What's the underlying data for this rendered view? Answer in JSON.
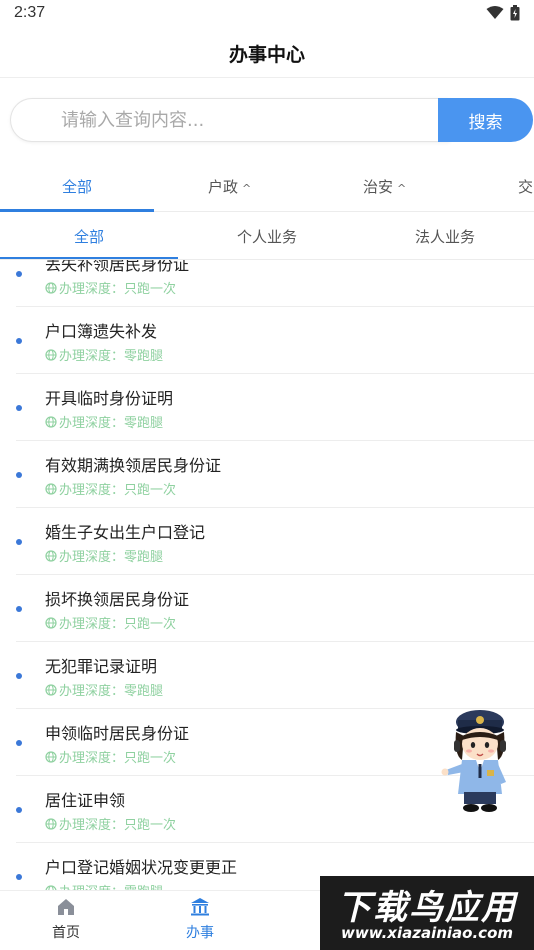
{
  "status_bar": {
    "time": "2:37"
  },
  "header": {
    "title": "办事中心"
  },
  "search": {
    "placeholder": "请输入查询内容...",
    "button_label": "搜索"
  },
  "category_tabs": [
    {
      "label": "全部",
      "active": true,
      "has_caret": false
    },
    {
      "label": "户政",
      "active": false,
      "has_caret": true
    },
    {
      "label": "治安",
      "active": false,
      "has_caret": true
    },
    {
      "label": "交",
      "active": false,
      "has_caret": false
    }
  ],
  "sub_tabs": [
    {
      "label": "全部",
      "active": true
    },
    {
      "label": "个人业务",
      "active": false
    },
    {
      "label": "法人业务",
      "active": false
    }
  ],
  "list": {
    "depth_prefix": "办理深度：",
    "items": [
      {
        "title": "丢失补领居民身份证",
        "depth": "只跑一次"
      },
      {
        "title": "户口簿遗失补发",
        "depth": "零跑腿"
      },
      {
        "title": "开具临时身份证明",
        "depth": "零跑腿"
      },
      {
        "title": "有效期满换领居民身份证",
        "depth": "只跑一次"
      },
      {
        "title": "婚生子女出生户口登记",
        "depth": "零跑腿"
      },
      {
        "title": "损坏换领居民身份证",
        "depth": "只跑一次"
      },
      {
        "title": "无犯罪记录证明",
        "depth": "零跑腿"
      },
      {
        "title": "申领临时居民身份证",
        "depth": "只跑一次"
      },
      {
        "title": "居住证申领",
        "depth": "只跑一次"
      },
      {
        "title": "户口登记婚姻状况变更更正",
        "depth": "零跑腿"
      }
    ]
  },
  "bottom_nav": [
    {
      "label": "首页",
      "icon": "home-icon",
      "active": false
    },
    {
      "label": "办事",
      "icon": "government-building-icon",
      "active": true
    }
  ],
  "watermark": {
    "title": "下载鸟应用",
    "url": "www.xiazainiao.com"
  },
  "colors": {
    "accent": "#2f7fdf",
    "search_button": "#4a95f0",
    "depth_text": "#8fd1a0",
    "bullet": "#3b78d8"
  }
}
